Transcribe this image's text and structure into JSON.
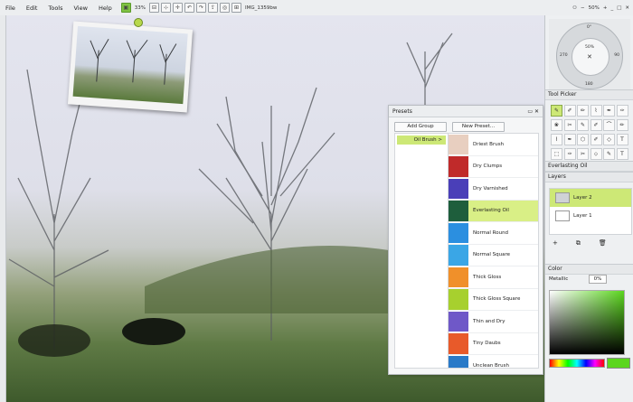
{
  "menu": [
    "File",
    "Edit",
    "Tools",
    "View",
    "Help"
  ],
  "toolbar": {
    "zoom_pct": "33%",
    "icons": [
      "layout-icon",
      "tool-icon",
      "move-icon",
      "undo-icon",
      "redo-icon",
      "export-icon",
      "globe-icon",
      "settings-icon"
    ],
    "filename": "IMG_1359bw"
  },
  "zoom": {
    "level": "50%"
  },
  "presets": {
    "title": "Presets",
    "add_group": "Add Group",
    "new_preset": "New Preset...",
    "group": "Oil Brush",
    "group_arrow": ">",
    "items": [
      {
        "label": "Driest Brush",
        "color": "#e8cfc0"
      },
      {
        "label": "Dry Clumps",
        "color": "#c02a2a"
      },
      {
        "label": "Dry Varnished",
        "color": "#4a3fb8"
      },
      {
        "label": "Everlasting Oil",
        "color": "#1e5e3c"
      },
      {
        "label": "Normal Round",
        "color": "#2b8fe0"
      },
      {
        "label": "Normal Square",
        "color": "#3aa6e6"
      },
      {
        "label": "Thick Gloss",
        "color": "#f0902a"
      },
      {
        "label": "Thick Gloss Square",
        "color": "#a7d02e"
      },
      {
        "label": "Thin and Dry",
        "color": "#6f58c8"
      },
      {
        "label": "Tiny Daubs",
        "color": "#e85a2a"
      },
      {
        "label": "Unclean Brush",
        "color": "#2a7ac8"
      }
    ],
    "selected_index": 3
  },
  "nav": {
    "top": "0°",
    "right": "90",
    "left": "270",
    "bottom": "180",
    "pct": "50%"
  },
  "tool_picker": {
    "title": "Tool Picker",
    "selected_tool": "Everlasting Oil",
    "tools": [
      "✎",
      "✐",
      "✏",
      "⌇",
      "✒",
      "✑",
      "❀",
      "✂",
      "✎",
      "✐",
      "⌒",
      "✏",
      "⌇",
      "✒",
      "⬡",
      "✐",
      "◇",
      "T",
      "⬚",
      "✑",
      "✂",
      "⬦",
      "✎",
      "T"
    ]
  },
  "layers": {
    "title": "Layers",
    "items": [
      {
        "name": "Layer 2",
        "active": true
      },
      {
        "name": "Layer 1",
        "active": false
      }
    ]
  },
  "color": {
    "title": "Color",
    "metallic_label": "Metallic",
    "metallic_value": "0%",
    "current": "#5bd61e"
  }
}
